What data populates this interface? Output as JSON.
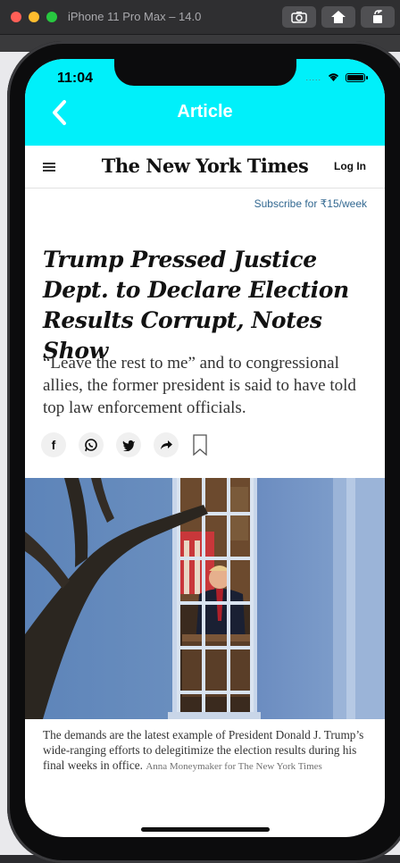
{
  "window": {
    "title": "iPhone 11 Pro Max – 14.0"
  },
  "status_bar": {
    "time": "11:04",
    "signal": "....."
  },
  "app_bar": {
    "title": "Article"
  },
  "nyt": {
    "masthead": "The New York Times",
    "login_label": "Log In",
    "subscribe_label": "Subscribe for ₹15/week"
  },
  "article": {
    "headline": "Trump Pressed Justice Dept. to Declare Election Results Corrupt, Notes Show",
    "summary": "“Leave the rest to me” and to congressional allies, the former president is said to have told top law enforcement officials.",
    "share_icons": [
      "facebook-icon",
      "whatsapp-icon",
      "twitter-icon",
      "share-arrow-icon",
      "bookmark-icon"
    ],
    "share_facebook_glyph": "f",
    "caption": "The demands are the latest example of President Donald J. Trump’s wide-ranging efforts to delegitimize the election results during his final weeks in office.",
    "credit": "Anna Moneymaker for The New York Times"
  },
  "colors": {
    "app_bar": "#00f0fa",
    "link": "#326891"
  }
}
